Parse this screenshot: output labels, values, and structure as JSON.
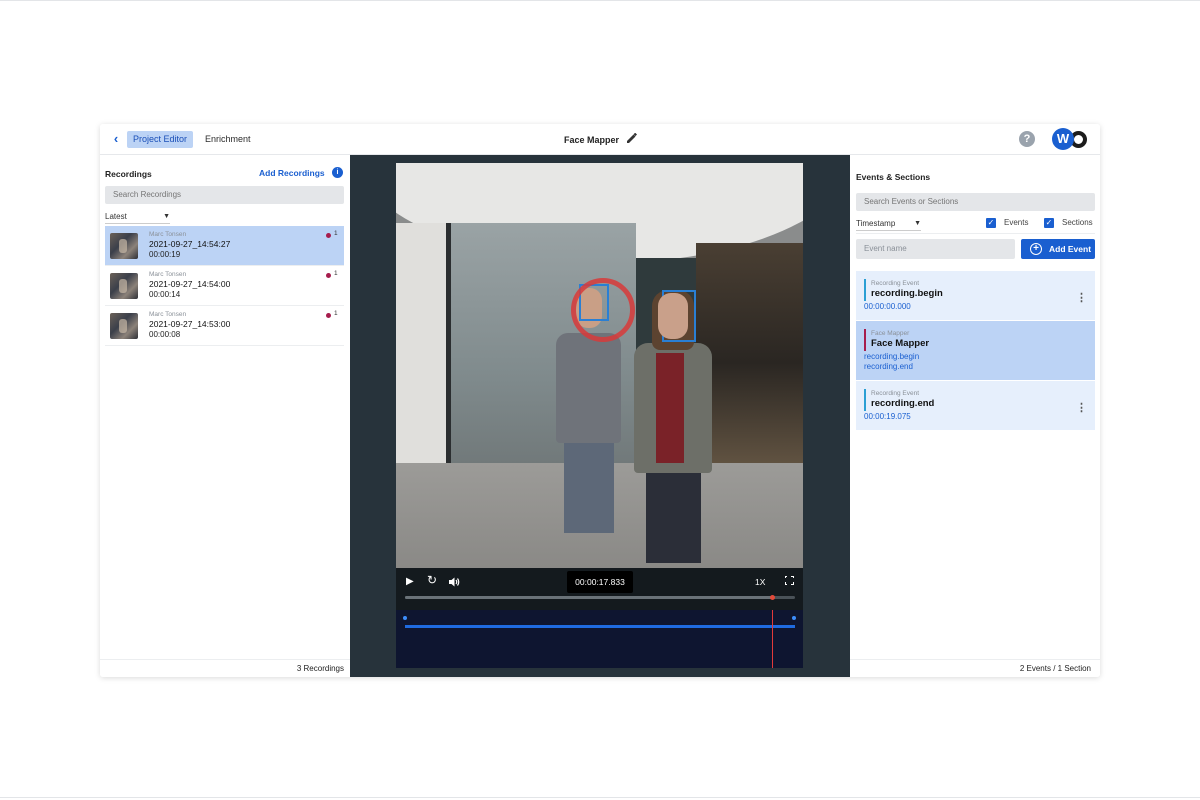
{
  "topbar": {
    "back_icon": "chevron-left-icon",
    "tabs": [
      {
        "label": "Project Editor",
        "active": true
      },
      {
        "label": "Enrichment",
        "active": false
      }
    ],
    "title": "Face Mapper",
    "edit_icon": "pencil-icon",
    "help_icon": "question-icon",
    "avatar_letter": "W"
  },
  "recordings": {
    "header": "Recordings",
    "add_label": "Add Recordings",
    "search_placeholder": "Search Recordings",
    "sort_label": "Latest",
    "items": [
      {
        "author": "Marc Tonsen",
        "name": "2021-09-27_14:54:27",
        "duration": "00:00:19",
        "count": "1",
        "selected": true
      },
      {
        "author": "Marc Tonsen",
        "name": "2021-09-27_14:54:00",
        "duration": "00:00:14",
        "count": "1",
        "selected": false
      },
      {
        "author": "Marc Tonsen",
        "name": "2021-09-27_14:53:00",
        "duration": "00:00:08",
        "count": "1",
        "selected": false
      }
    ],
    "footer": "3 Recordings"
  },
  "player": {
    "current_time": "00:00:17.833",
    "speed": "1X",
    "progress_fraction": 0.94,
    "icons": [
      "play-icon",
      "loop-icon",
      "volume-icon",
      "fullscreen-icon"
    ]
  },
  "events": {
    "header": "Events & Sections",
    "search_placeholder": "Search Events or Sections",
    "sort_label": "Timestamp",
    "filter_events": "Events",
    "filter_sections": "Sections",
    "name_placeholder": "Event name",
    "add_label": "Add Event",
    "items": [
      {
        "kind": "Recording Event",
        "name": "recording.begin",
        "links": [
          "00:00:00.000"
        ],
        "color": "#2a9fd4",
        "selected": false,
        "has_menu": true
      },
      {
        "kind": "Face Mapper",
        "name": "Face Mapper",
        "links": [
          "recording.begin",
          "recording.end"
        ],
        "color": "#a61d4d",
        "selected": true,
        "has_menu": false
      },
      {
        "kind": "Recording Event",
        "name": "recording.end",
        "links": [
          "00:00:19.075"
        ],
        "color": "#2a9fd4",
        "selected": false,
        "has_menu": true
      }
    ],
    "footer": "2 Events / 1 Section"
  },
  "colors": {
    "accent": "#1a5fd0",
    "selected_bg": "#bcd3f5",
    "gaze": "#d83a3a",
    "face_box": "#2a7fd4"
  }
}
